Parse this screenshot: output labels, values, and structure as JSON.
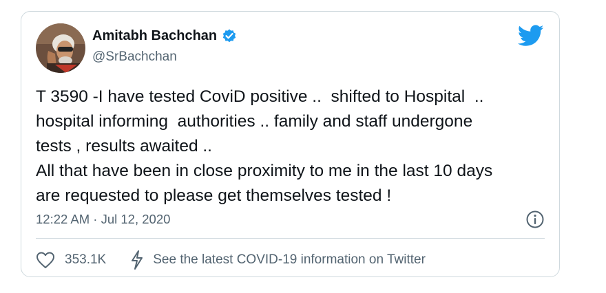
{
  "author": {
    "display_name": "Amitabh Bachchan",
    "handle": "@SrBachchan",
    "verified": true
  },
  "tweet": {
    "lines": [
      "T 3590 -I have tested CoviD positive ..  shifted to Hospital  ..",
      "hospital informing  authorities .. family and staff undergone",
      "tests , results awaited ..",
      "All that have been in close proximity to me in the last 10 days",
      "are requested to please get themselves tested !"
    ],
    "timestamp": "12:22 AM · Jul 12, 2020"
  },
  "actions": {
    "like_count": "353.1K",
    "covid_info_label": "See the latest COVID-19 information on Twitter"
  },
  "icons": {
    "brand": "twitter-bird-icon",
    "verified": "verified-badge-icon",
    "info": "info-icon",
    "like": "heart-icon",
    "bolt": "lightning-bolt-icon"
  },
  "colors": {
    "twitter_blue": "#1d9bf0",
    "secondary_text": "#536471",
    "primary_text": "#0f1419",
    "border": "#cfd9de"
  }
}
